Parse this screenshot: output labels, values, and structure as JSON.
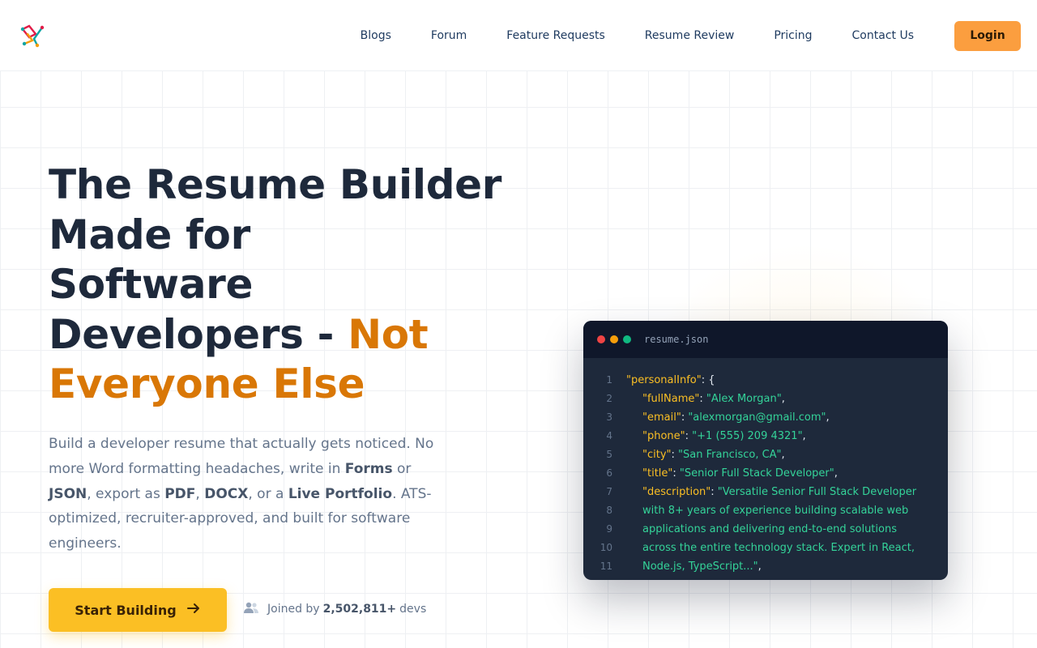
{
  "nav": {
    "logo_icon": "fork-logo-icon",
    "links": [
      "Blogs",
      "Forum",
      "Feature Requests",
      "Resume Review",
      "Pricing",
      "Contact Us"
    ],
    "login_label": "Login"
  },
  "hero": {
    "title_part1_line1": "The Resume Builder",
    "title_part1_line2": "Made for",
    "title_part1_line3": "Software",
    "title_part1_line4": "Developers - ",
    "title_accent_1": "Not",
    "title_accent_2": "Everyone Else",
    "desc_1": "Build a developer resume that actually gets noticed. No more Word formatting headaches, write in ",
    "desc_forms": "Forms",
    "desc_2": " or ",
    "desc_json": "JSON",
    "desc_3": ", export as ",
    "desc_pdf": "PDF",
    "desc_4": ", ",
    "desc_docx": "DOCX",
    "desc_5": ", or a ",
    "desc_portfolio": "Live Portfolio",
    "desc_6": ". ATS-optimized, recruiter-approved, and built for software engineers.",
    "cta_label": "Start Building",
    "cta_icon": "arrow-right-icon",
    "joined_prefix": "Joined by",
    "joined_count": "2,502,811+",
    "joined_suffix": "devs",
    "joined_icon": "users-icon"
  },
  "code_window": {
    "filename": "resume.json",
    "lines": [
      {
        "num": "1",
        "key": "\"personalInfo\"",
        "sep": ": {",
        "val": ""
      },
      {
        "num": "2",
        "key": "\"fullName\"",
        "sep": ": ",
        "val": "\"Alex Morgan\"",
        "end": ","
      },
      {
        "num": "3",
        "key": "\"email\"",
        "sep": ": ",
        "val": "\"alexmorgan@gmail.com\"",
        "end": ","
      },
      {
        "num": "4",
        "key": "\"phone\"",
        "sep": ": ",
        "val": "\"+1 (555) 209 4321\"",
        "end": ","
      },
      {
        "num": "5",
        "key": "\"city\"",
        "sep": ": ",
        "val": "\"San Francisco, CA\"",
        "end": ","
      },
      {
        "num": "6",
        "key": "\"title\"",
        "sep": ": ",
        "val": "\"Senior Full Stack Developer\"",
        "end": ","
      },
      {
        "num": "7",
        "key": "\"description\"",
        "sep": ": ",
        "val": "\"Versatile Senior Full Stack Developer",
        "end": ""
      },
      {
        "num": "8",
        "key": "",
        "sep": "",
        "val": "with 8+ years of experience building scalable web",
        "end": ""
      },
      {
        "num": "9",
        "key": "",
        "sep": "",
        "val": "applications and delivering end-to-end solutions",
        "end": ""
      },
      {
        "num": "10",
        "key": "",
        "sep": "",
        "val": "across the entire technology stack. Expert in React,",
        "end": ""
      },
      {
        "num": "11",
        "key": "",
        "sep": "",
        "val": "Node.js, TypeScript...\"",
        "end": ","
      }
    ]
  }
}
